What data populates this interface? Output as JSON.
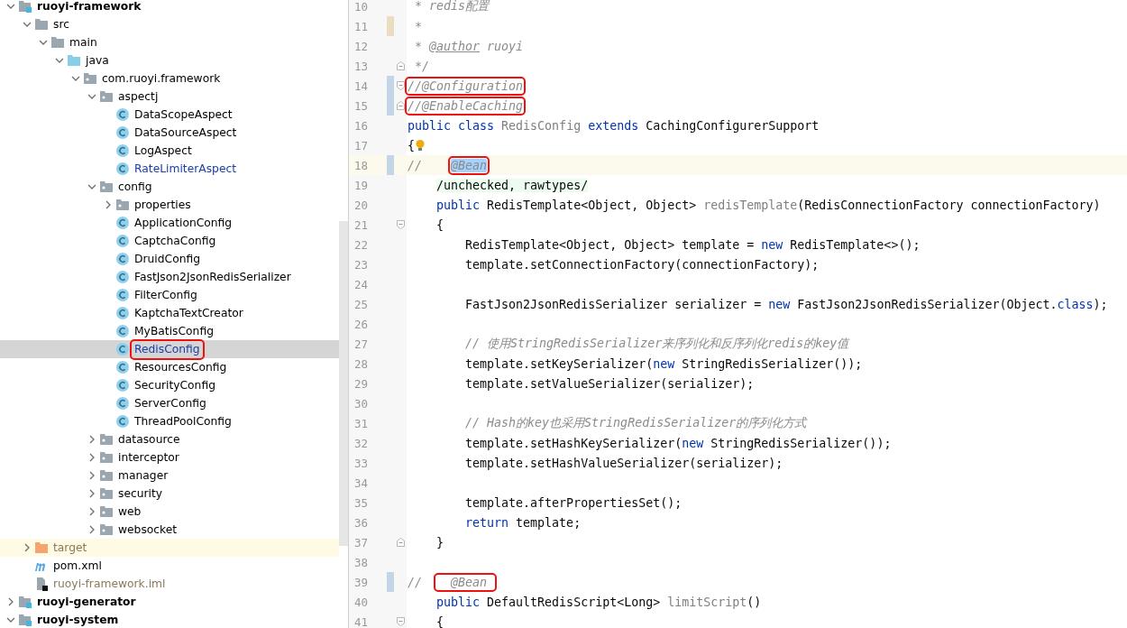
{
  "project_tree": [
    {
      "label": "ruoyi-framework",
      "kind": "module",
      "expanded": true,
      "selected": false,
      "children": [
        {
          "label": "src",
          "kind": "folder",
          "expanded": true,
          "selected": false,
          "children": [
            {
              "label": "main",
              "kind": "folder",
              "expanded": true,
              "selected": false,
              "children": [
                {
                  "label": "java",
                  "kind": "source-root",
                  "expanded": true,
                  "selected": false,
                  "children": [
                    {
                      "label": "com.ruoyi.framework",
                      "kind": "package",
                      "expanded": true,
                      "selected": false,
                      "children": [
                        {
                          "label": "aspectj",
                          "kind": "package",
                          "expanded": true,
                          "selected": false,
                          "children": [
                            {
                              "label": "DataScopeAspect",
                              "kind": "class",
                              "selected": false
                            },
                            {
                              "label": "DataSourceAspect",
                              "kind": "class",
                              "selected": false
                            },
                            {
                              "label": "LogAspect",
                              "kind": "class",
                              "selected": false
                            },
                            {
                              "label": "RateLimiterAspect",
                              "kind": "class",
                              "modified": true,
                              "selected": false
                            }
                          ]
                        },
                        {
                          "label": "config",
                          "kind": "package",
                          "expanded": true,
                          "selected": false,
                          "children": [
                            {
                              "label": "properties",
                              "kind": "package",
                              "expanded": false,
                              "selected": false
                            },
                            {
                              "label": "ApplicationConfig",
                              "kind": "class",
                              "selected": false
                            },
                            {
                              "label": "CaptchaConfig",
                              "kind": "class",
                              "selected": false
                            },
                            {
                              "label": "DruidConfig",
                              "kind": "class",
                              "selected": false
                            },
                            {
                              "label": "FastJson2JsonRedisSerializer",
                              "kind": "class",
                              "selected": false
                            },
                            {
                              "label": "FilterConfig",
                              "kind": "class",
                              "selected": false
                            },
                            {
                              "label": "KaptchaTextCreator",
                              "kind": "class",
                              "selected": false
                            },
                            {
                              "label": "MyBatisConfig",
                              "kind": "class",
                              "selected": false
                            },
                            {
                              "label": "RedisConfig",
                              "kind": "class",
                              "modified": true,
                              "selected": true,
                              "boxed": true
                            },
                            {
                              "label": "ResourcesConfig",
                              "kind": "class",
                              "selected": false
                            },
                            {
                              "label": "SecurityConfig",
                              "kind": "class",
                              "selected": false
                            },
                            {
                              "label": "ServerConfig",
                              "kind": "class",
                              "selected": false
                            },
                            {
                              "label": "ThreadPoolConfig",
                              "kind": "class",
                              "selected": false
                            }
                          ]
                        },
                        {
                          "label": "datasource",
                          "kind": "package",
                          "expanded": false,
                          "selected": false
                        },
                        {
                          "label": "interceptor",
                          "kind": "package",
                          "expanded": false,
                          "selected": false
                        },
                        {
                          "label": "manager",
                          "kind": "package",
                          "expanded": false,
                          "selected": false
                        },
                        {
                          "label": "security",
                          "kind": "package",
                          "expanded": false,
                          "selected": false
                        },
                        {
                          "label": "web",
                          "kind": "package",
                          "expanded": false,
                          "selected": false
                        },
                        {
                          "label": "websocket",
                          "kind": "package",
                          "expanded": false,
                          "selected": false
                        }
                      ]
                    }
                  ]
                }
              ]
            }
          ]
        },
        {
          "label": "target",
          "kind": "excluded",
          "expanded": false,
          "ignored": true,
          "selected": false
        },
        {
          "label": "pom.xml",
          "kind": "maven",
          "selected": false
        },
        {
          "label": "ruoyi-framework.iml",
          "kind": "iml",
          "ignored": true,
          "selected": false
        }
      ]
    },
    {
      "label": "ruoyi-generator",
      "kind": "module",
      "expanded": false,
      "selected": false
    },
    {
      "label": "ruoyi-system",
      "kind": "module",
      "expanded": true,
      "selected": false
    }
  ],
  "editor": {
    "lines": [
      {
        "number": "10",
        "tokens": [
          {
            "kind": "comment",
            "text": " * redis配置"
          }
        ]
      },
      {
        "number": "11",
        "unsaved": true,
        "tokens": [
          {
            "kind": "comment",
            "text": " *"
          }
        ]
      },
      {
        "number": "12",
        "tokens": [
          {
            "kind": "comment",
            "text": " * "
          },
          {
            "kind": "doc-tag",
            "text": "@author"
          },
          {
            "kind": "comment",
            "text": " ruoyi"
          }
        ]
      },
      {
        "number": "13",
        "fold_end": true,
        "tokens": [
          {
            "kind": "comment",
            "text": " */"
          }
        ]
      },
      {
        "number": "14",
        "modified": true,
        "fold_start": true,
        "tokens": [
          {
            "kind": "comment",
            "text": "//@Configuration",
            "boxed": true
          }
        ]
      },
      {
        "number": "15",
        "modified": true,
        "fold_end": true,
        "tokens": [
          {
            "kind": "comment",
            "text": "//@EnableCaching",
            "boxed": true
          }
        ]
      },
      {
        "number": "16",
        "tokens": [
          {
            "kind": "keyword",
            "text": "public class "
          },
          {
            "kind": "unused",
            "text": "RedisConfig"
          },
          {
            "kind": "keyword",
            "text": " extends "
          },
          {
            "kind": "plain",
            "text": "CachingConfigurerSupport"
          }
        ]
      },
      {
        "number": "17",
        "intention": true,
        "tokens": [
          {
            "kind": "plain",
            "text": "{"
          }
        ]
      },
      {
        "number": "18",
        "modified": true,
        "current": true,
        "tokens": [
          {
            "kind": "comment",
            "text": "//    "
          },
          {
            "kind": "comment",
            "text": "@Bean",
            "boxed": true,
            "selected": true
          }
        ]
      },
      {
        "number": "19",
        "tokens": [
          {
            "kind": "suppression",
            "text": "    /unchecked, rawtypes/"
          }
        ]
      },
      {
        "number": "20",
        "tokens": [
          {
            "kind": "keyword",
            "text": "    public "
          },
          {
            "kind": "plain",
            "text": "RedisTemplate<Object, Object> "
          },
          {
            "kind": "unused",
            "text": "redisTemplate"
          },
          {
            "kind": "plain",
            "text": "(RedisConnectionFactory connectionFactory)"
          }
        ]
      },
      {
        "number": "21",
        "fold_start": true,
        "tokens": [
          {
            "kind": "plain",
            "text": "    {"
          }
        ]
      },
      {
        "number": "22",
        "tokens": [
          {
            "kind": "plain",
            "text": "        RedisTemplate<Object, Object> template = "
          },
          {
            "kind": "keyword",
            "text": "new"
          },
          {
            "kind": "plain",
            "text": " RedisTemplate<>();"
          }
        ]
      },
      {
        "number": "23",
        "tokens": [
          {
            "kind": "plain",
            "text": "        template.setConnectionFactory(connectionFactory);"
          }
        ]
      },
      {
        "number": "24"
      },
      {
        "number": "25",
        "tokens": [
          {
            "kind": "plain",
            "text": "        FastJson2JsonRedisSerializer serializer = "
          },
          {
            "kind": "keyword",
            "text": "new"
          },
          {
            "kind": "plain",
            "text": " FastJson2JsonRedisSerializer(Object."
          },
          {
            "kind": "keyword",
            "text": "class"
          },
          {
            "kind": "plain",
            "text": ");"
          }
        ]
      },
      {
        "number": "26"
      },
      {
        "number": "27",
        "tokens": [
          {
            "kind": "comment",
            "text": "        // 使用StringRedisSerializer来序列化和反序列化redis的key值"
          }
        ]
      },
      {
        "number": "28",
        "tokens": [
          {
            "kind": "plain",
            "text": "        template.setKeySerializer("
          },
          {
            "kind": "keyword",
            "text": "new"
          },
          {
            "kind": "plain",
            "text": " StringRedisSerializer());"
          }
        ]
      },
      {
        "number": "29",
        "tokens": [
          {
            "kind": "plain",
            "text": "        template.setValueSerializer(serializer);"
          }
        ]
      },
      {
        "number": "30"
      },
      {
        "number": "31",
        "tokens": [
          {
            "kind": "comment",
            "text": "        // Hash的key也采用StringRedisSerializer的序列化方式"
          }
        ]
      },
      {
        "number": "32",
        "tokens": [
          {
            "kind": "plain",
            "text": "        template.setHashKeySerializer("
          },
          {
            "kind": "keyword",
            "text": "new"
          },
          {
            "kind": "plain",
            "text": " StringRedisSerializer());"
          }
        ]
      },
      {
        "number": "33",
        "tokens": [
          {
            "kind": "plain",
            "text": "        template.setHashValueSerializer(serializer);"
          }
        ]
      },
      {
        "number": "34"
      },
      {
        "number": "35",
        "tokens": [
          {
            "kind": "plain",
            "text": "        template.afterPropertiesSet();"
          }
        ]
      },
      {
        "number": "36",
        "tokens": [
          {
            "kind": "keyword",
            "text": "        return"
          },
          {
            "kind": "plain",
            "text": " template;"
          }
        ]
      },
      {
        "number": "37",
        "fold_end": true,
        "tokens": [
          {
            "kind": "plain",
            "text": "    }"
          }
        ]
      },
      {
        "number": "38"
      },
      {
        "number": "39",
        "modified": true,
        "tokens": [
          {
            "kind": "comment",
            "text": "//  "
          },
          {
            "kind": "comment",
            "text": "  @Bean ",
            "boxed": true
          }
        ]
      },
      {
        "number": "40",
        "tokens": [
          {
            "kind": "keyword",
            "text": "    public "
          },
          {
            "kind": "plain",
            "text": "DefaultRedisScript<Long> "
          },
          {
            "kind": "unused",
            "text": "limitScript"
          },
          {
            "kind": "plain",
            "text": "()"
          }
        ]
      },
      {
        "number": "41",
        "fold_start": true,
        "tokens": [
          {
            "kind": "plain",
            "text": "    {"
          }
        ]
      }
    ]
  }
}
